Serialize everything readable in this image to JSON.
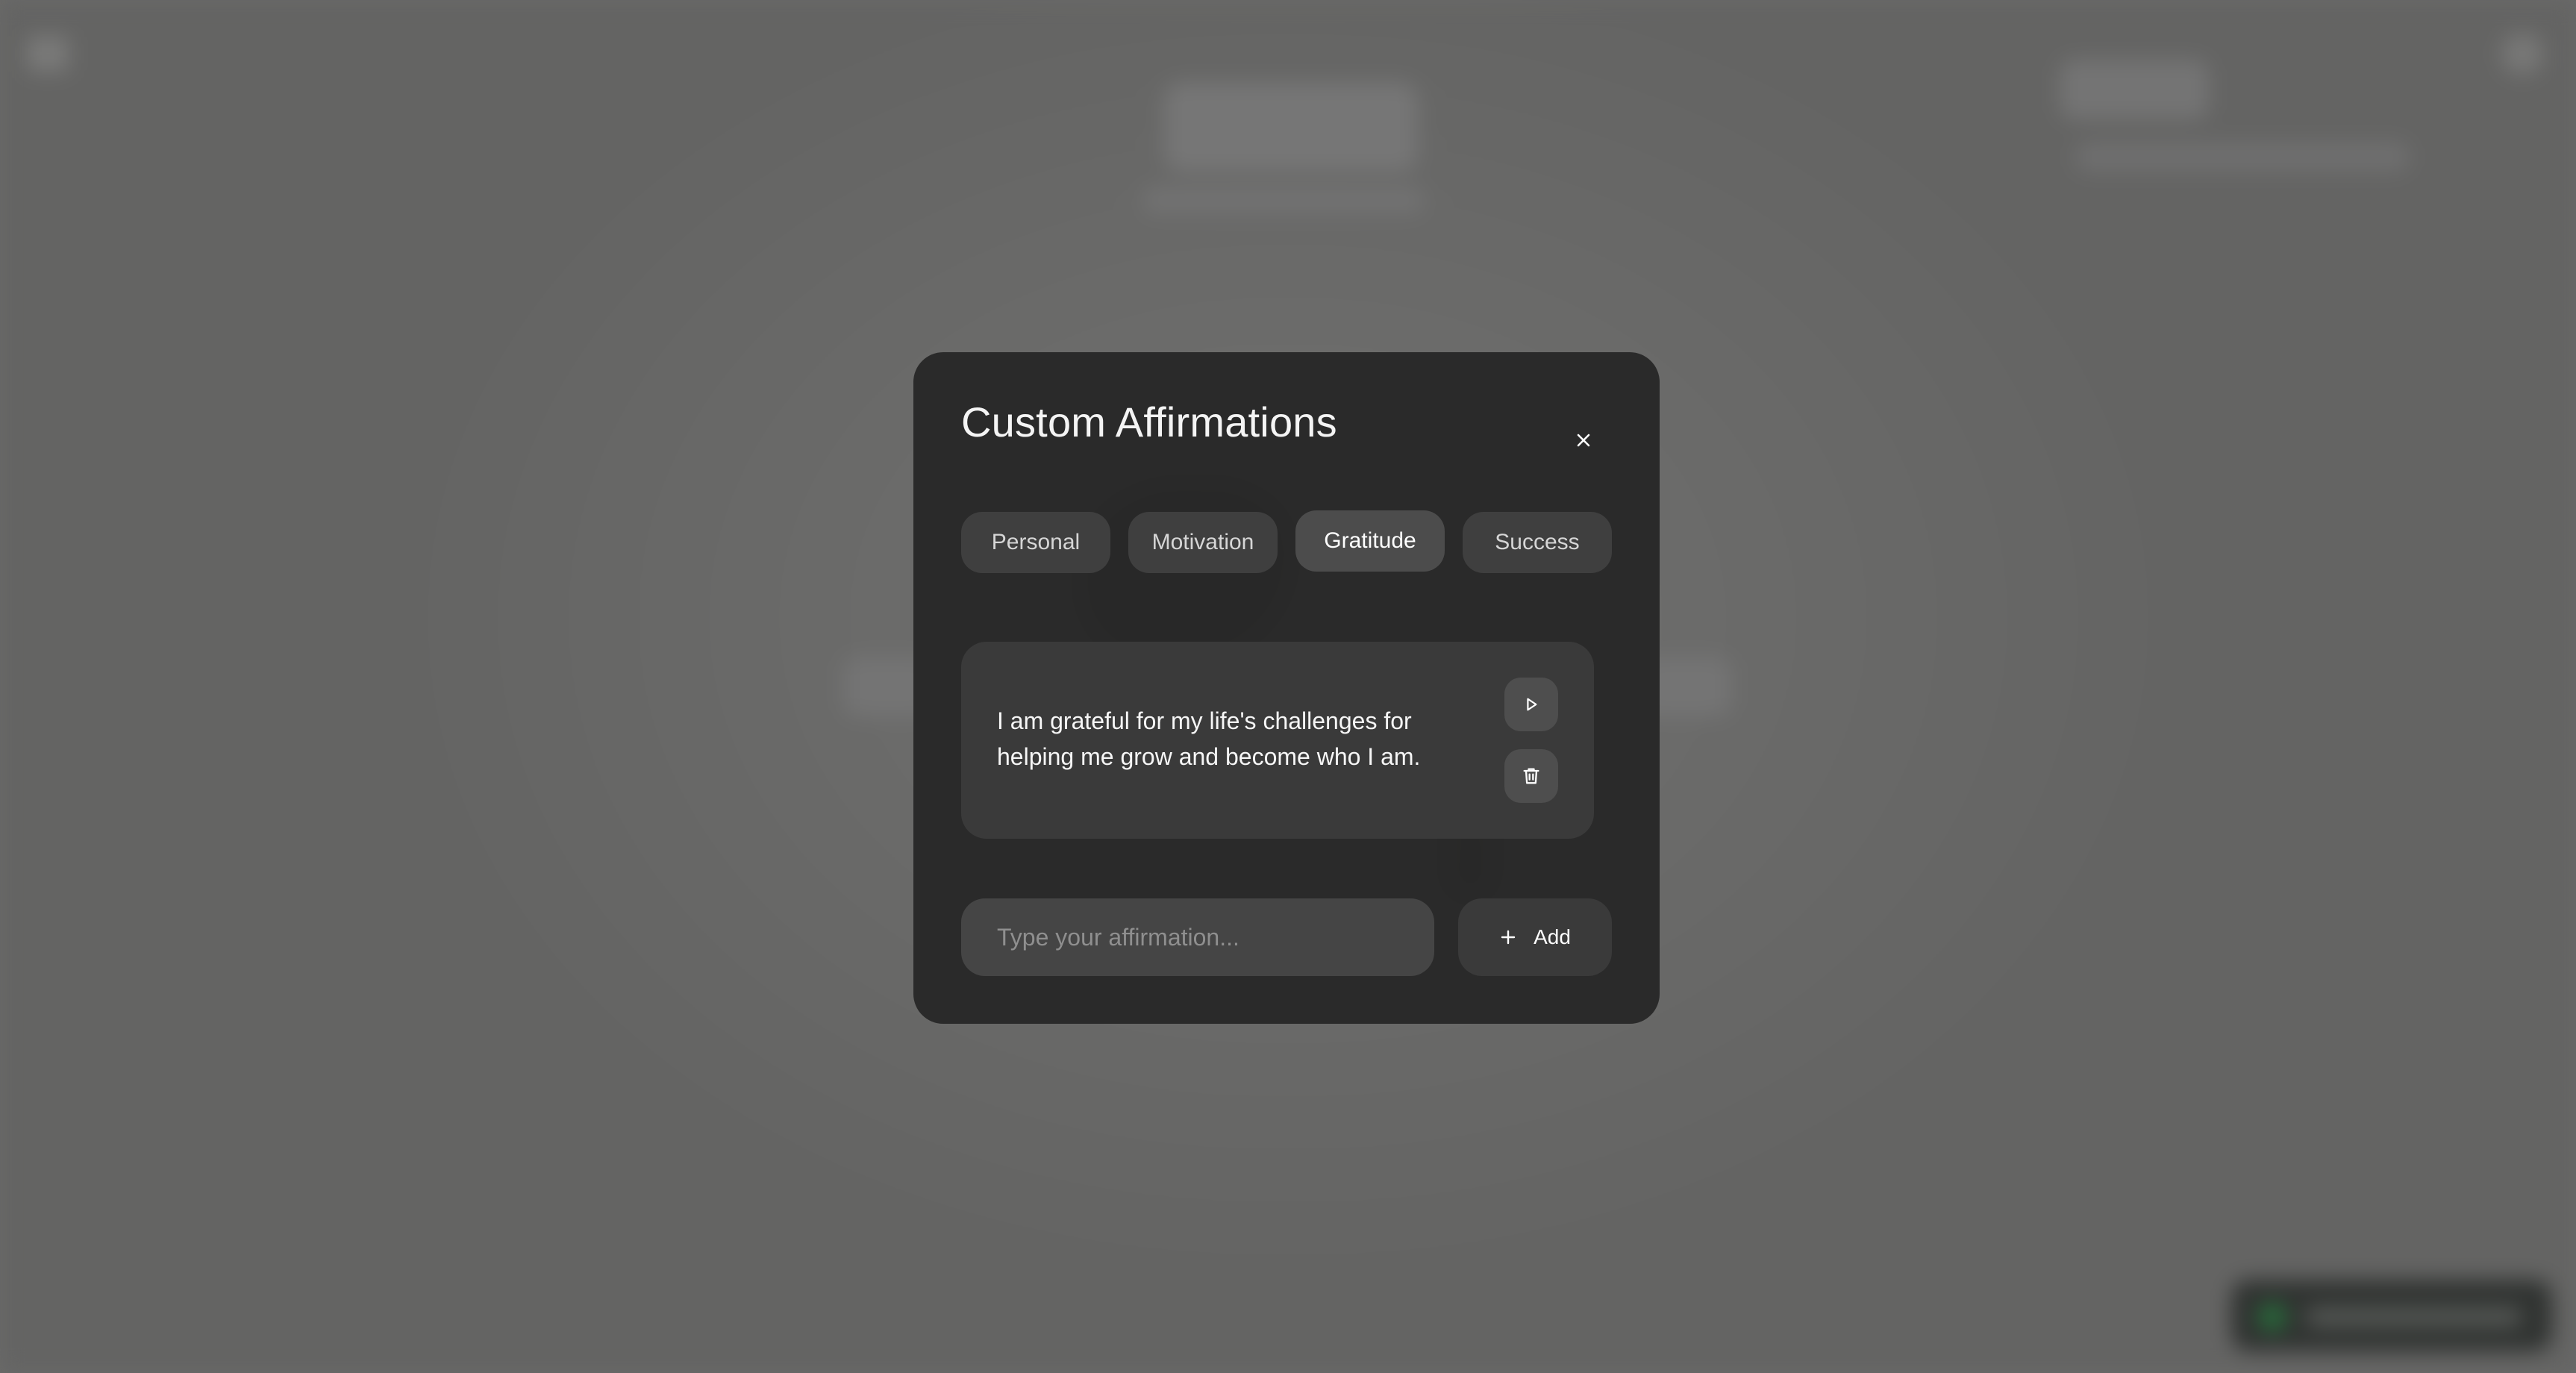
{
  "modal": {
    "title": "Custom Affirmations",
    "close_icon": "close-icon"
  },
  "tabs": [
    {
      "label": "Personal",
      "active": false
    },
    {
      "label": "Motivation",
      "active": false
    },
    {
      "label": "Gratitude",
      "active": true
    },
    {
      "label": "Success",
      "active": false
    }
  ],
  "affirmations": [
    {
      "text": "I am grateful for my life's challenges for helping me grow and become who I am.",
      "play_icon": "play-icon",
      "delete_icon": "trash-icon"
    }
  ],
  "new_affirmation": {
    "value": "",
    "placeholder": "Type your affirmation..."
  },
  "add_button": {
    "label": "Add",
    "icon": "plus-icon"
  },
  "colors": {
    "overlay": "#6a6a69",
    "modal_bg": "#282828",
    "tab_bg": "#3f3f3f",
    "tab_active_bg": "#4c4c4c",
    "card_bg": "#3a3a3a",
    "text": "#ffffff"
  }
}
